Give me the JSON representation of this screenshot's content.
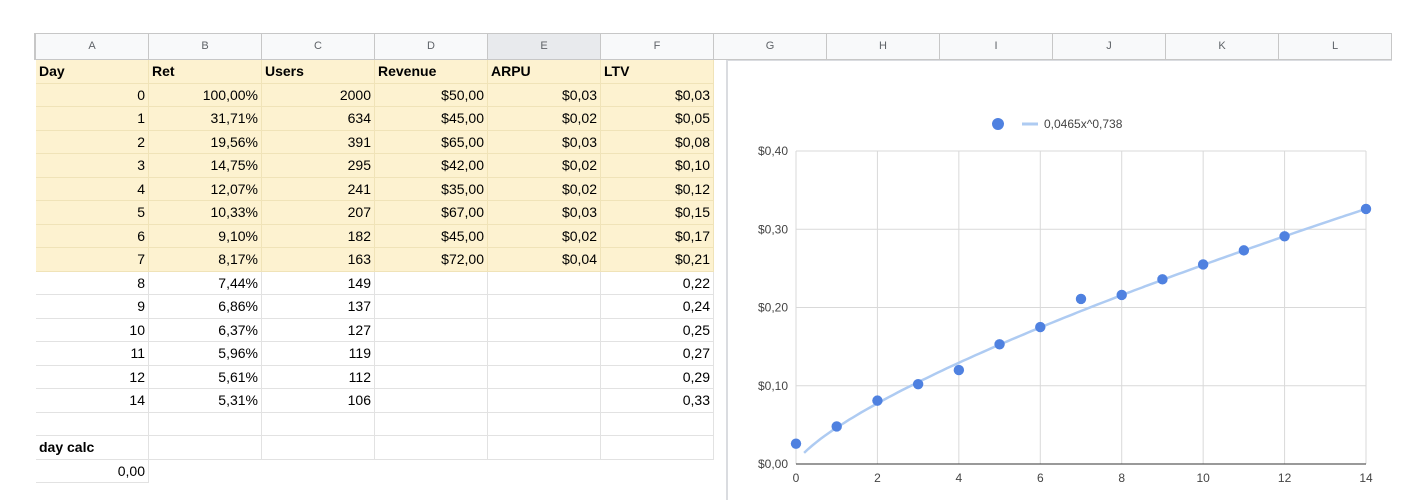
{
  "columns": [
    "A",
    "B",
    "C",
    "D",
    "E",
    "F",
    "G",
    "H",
    "I",
    "J",
    "K",
    "L"
  ],
  "selected_column": "E",
  "table": {
    "header": [
      "Day",
      "Ret",
      "Users",
      "Revenue",
      "ARPU",
      "LTV"
    ],
    "rows": [
      [
        "0",
        "100,00%",
        "2000",
        "$50,00",
        "$0,03",
        "$0,03"
      ],
      [
        "1",
        "31,71%",
        "634",
        "$45,00",
        "$0,02",
        "$0,05"
      ],
      [
        "2",
        "19,56%",
        "391",
        "$65,00",
        "$0,03",
        "$0,08"
      ],
      [
        "3",
        "14,75%",
        "295",
        "$42,00",
        "$0,02",
        "$0,10"
      ],
      [
        "4",
        "12,07%",
        "241",
        "$35,00",
        "$0,02",
        "$0,12"
      ],
      [
        "5",
        "10,33%",
        "207",
        "$67,00",
        "$0,03",
        "$0,15"
      ],
      [
        "6",
        "9,10%",
        "182",
        "$45,00",
        "$0,02",
        "$0,17"
      ],
      [
        "7",
        "8,17%",
        "163",
        "$72,00",
        "$0,04",
        "$0,21"
      ],
      [
        "8",
        "7,44%",
        "149",
        "",
        "",
        "0,22"
      ],
      [
        "9",
        "6,86%",
        "137",
        "",
        "",
        "0,24"
      ],
      [
        "10",
        "6,37%",
        "127",
        "",
        "",
        "0,25"
      ],
      [
        "11",
        "5,96%",
        "119",
        "",
        "",
        "0,27"
      ],
      [
        "12",
        "5,61%",
        "112",
        "",
        "",
        "0,29"
      ],
      [
        "14",
        "5,31%",
        "106",
        "",
        "",
        "0,33"
      ],
      [
        "",
        "",
        "",
        "",
        "",
        ""
      ]
    ],
    "footer_label": "day calc",
    "footer_partial_value": "0,00"
  },
  "chart_data": {
    "type": "scatter",
    "title": "",
    "xlabel": "",
    "ylabel": "",
    "xlim": [
      0,
      14
    ],
    "ylim": [
      0,
      0.4
    ],
    "x_ticks": [
      "0",
      "2",
      "4",
      "6",
      "8",
      "10",
      "12",
      "14"
    ],
    "y_ticks": [
      "$0,00",
      "$0,10",
      "$0,20",
      "$0,30",
      "$0,40"
    ],
    "grid": true,
    "point_color": "#4f81e0",
    "trend_color": "#aecbf2",
    "legend_position": "top",
    "legend_label": "0,0465x^0,738",
    "trendline": {
      "type": "power",
      "a": 0.0465,
      "b": 0.738
    },
    "series": [
      {
        "x": [
          0,
          1,
          2,
          3,
          4,
          5,
          6,
          7,
          8,
          9,
          10,
          11,
          12,
          14
        ],
        "y": [
          0.026,
          0.048,
          0.081,
          0.102,
          0.12,
          0.153,
          0.175,
          0.211,
          0.216,
          0.236,
          0.255,
          0.273,
          0.291,
          0.326
        ]
      }
    ]
  }
}
